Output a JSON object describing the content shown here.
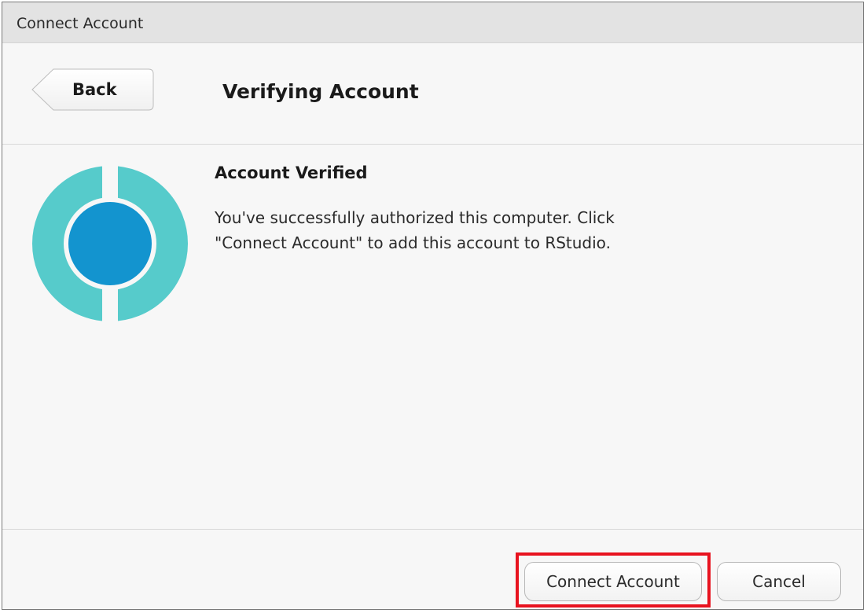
{
  "window": {
    "title": "Connect Account"
  },
  "header": {
    "back_label": "Back",
    "title": "Verifying Account"
  },
  "status": {
    "heading": "Account Verified",
    "message": "You've successfully authorized this computer. Click \"Connect Account\" to add this account to RStudio."
  },
  "logo": {
    "icon": "account-service-logo-icon",
    "outer_color": "#56cbcb",
    "inner_color": "#1394cf"
  },
  "footer": {
    "connect_label": "Connect Account",
    "cancel_label": "Cancel",
    "highlight_color": "#e8131f"
  }
}
